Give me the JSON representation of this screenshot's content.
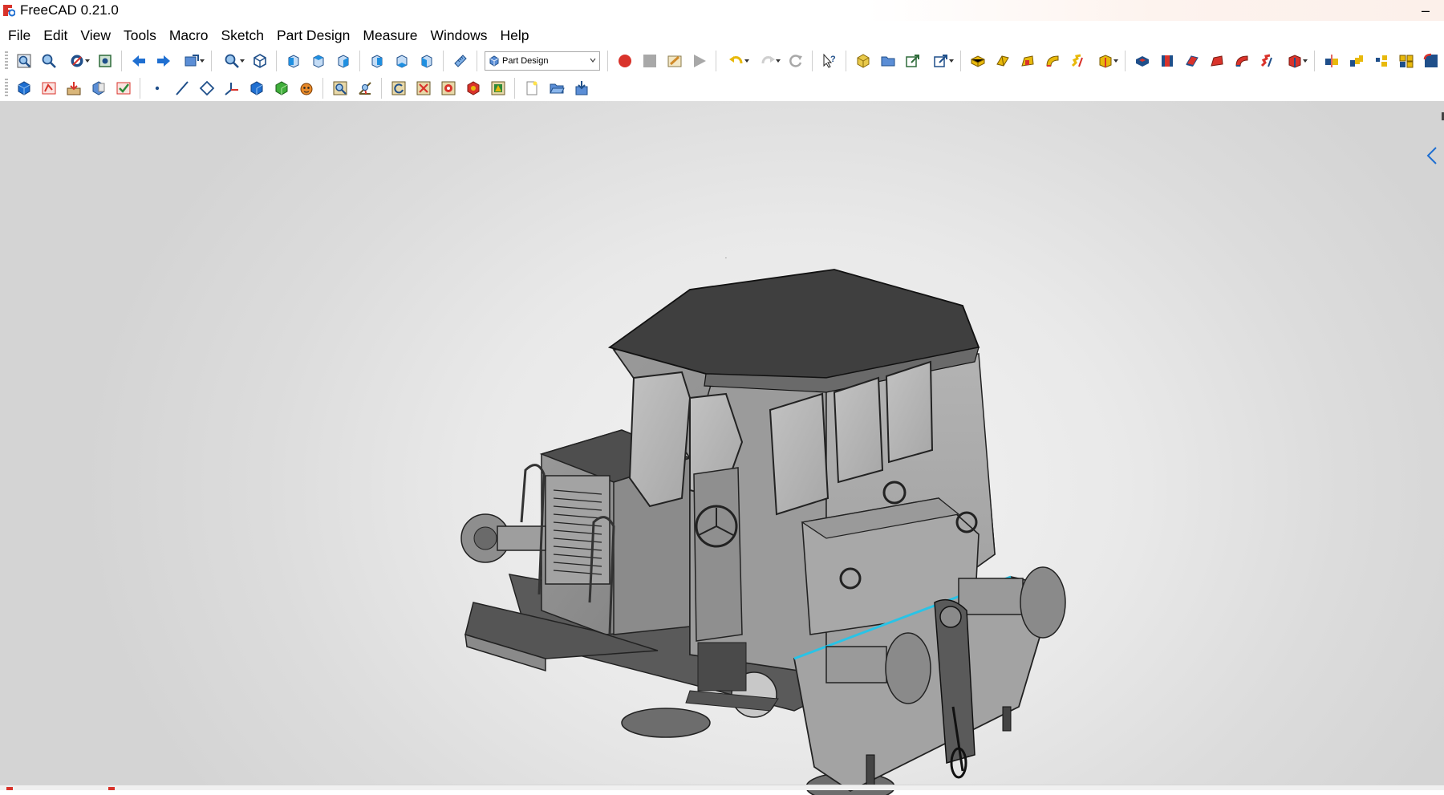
{
  "window": {
    "title": "FreeCAD 0.21.0",
    "minimize_glyph": "–"
  },
  "menu": [
    "File",
    "Edit",
    "View",
    "Tools",
    "Macro",
    "Sketch",
    "Part Design",
    "Measure",
    "Windows",
    "Help"
  ],
  "workbench_selector": {
    "selected": "Part Design"
  },
  "toolbar_row1": [
    "fit-all-icon",
    "fit-selection-icon",
    "draw-style-icon",
    "bounding-box-icon",
    "nav-back-icon",
    "nav-forward-icon",
    "sync-view-icon",
    "zoom-icon",
    "isometric-view-icon",
    "front-view-icon",
    "top-view-icon",
    "right-view-icon",
    "rear-view-icon",
    "bottom-view-icon",
    "left-view-icon",
    "measure-distance-icon",
    "macro-record-icon",
    "macro-stop-icon",
    "macro-edit-icon",
    "macro-run-icon",
    "undo-icon",
    "redo-icon",
    "refresh-icon",
    "whats-this-icon",
    "create-body-icon",
    "create-group-icon",
    "create-link-icon",
    "link-actions-icon",
    "pad-icon",
    "revolution-icon",
    "additive-loft-icon",
    "additive-pipe-icon",
    "additive-helix-icon",
    "additive-primitive-icon",
    "pocket-icon",
    "hole-icon",
    "groove-icon",
    "subtractive-loft-icon",
    "subtractive-pipe-icon",
    "subtractive-helix-icon",
    "subtractive-primitive-icon",
    "mirrored-icon",
    "linear-pattern-icon",
    "polar-pattern-icon",
    "multi-transform-icon",
    "fillet-icon"
  ],
  "toolbar_row2": [
    "body-icon",
    "create-sketch-icon",
    "attach-sketch-icon",
    "validate-sketch-icon",
    "check-geometry-icon",
    "datum-point-icon",
    "datum-line-icon",
    "datum-plane-icon",
    "local-cs-icon",
    "shape-binder-icon",
    "subshape-binder-icon",
    "clone-icon",
    "measure-linear-icon",
    "measure-angular-icon",
    "measure-refresh-icon",
    "measure-clear-icon",
    "measure-toggle-icon",
    "measure-toggle-3d-icon",
    "measure-delta-icon",
    "new-document-icon",
    "open-document-icon",
    "save-document-icon"
  ],
  "colors": {
    "accent_blue": "#1f6fd1",
    "macro_red": "#d9332b",
    "part_yellow": "#e8b90c",
    "selected_edge": "#29c3e6"
  },
  "viewport": {
    "content": "3D model of a small diesel shunting locomotive in grey shaded view"
  }
}
